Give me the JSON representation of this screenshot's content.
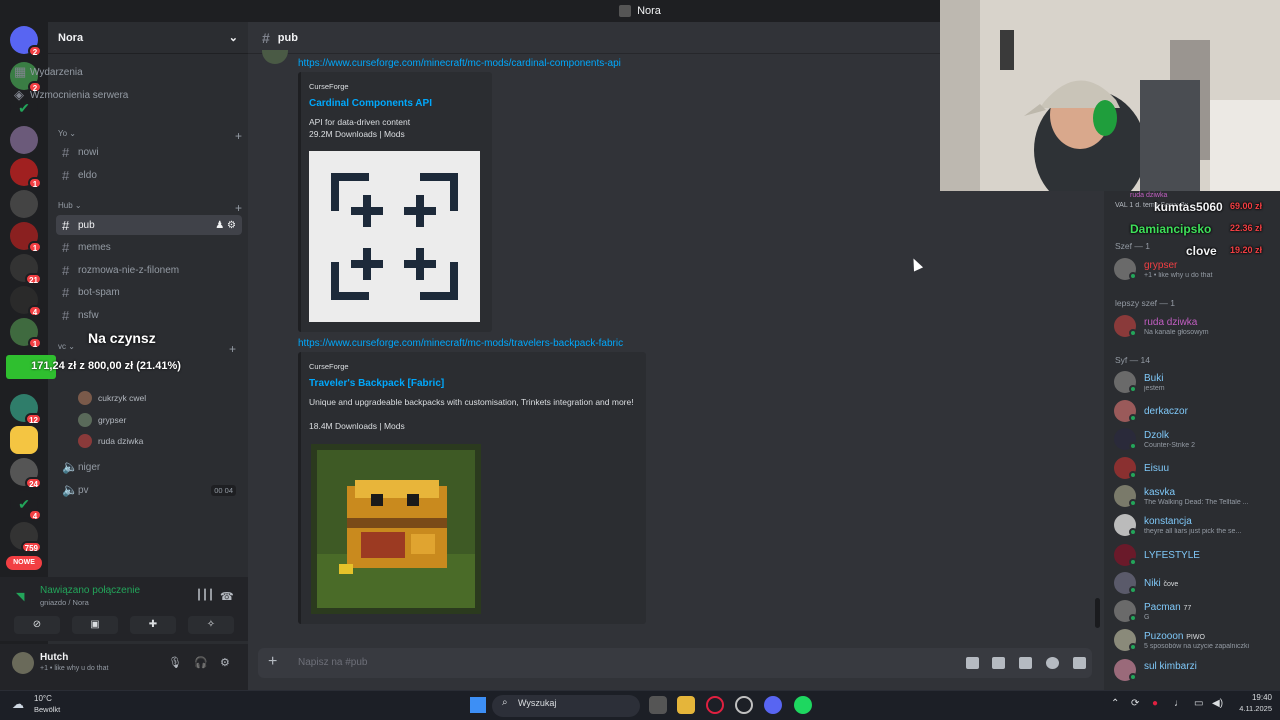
{
  "window": {
    "title": "Nora"
  },
  "server": {
    "name": "Nora",
    "top_items": [
      "Wydarzenia",
      "Wzmocnienia serwera"
    ],
    "categories": [
      {
        "name": "Yo",
        "channels": [
          "nowi",
          "eldo"
        ]
      },
      {
        "name": "Hub",
        "channels": [
          "pub",
          "memes",
          "rozmowa-nie-z-filonem",
          "bot-spam",
          "nsfw"
        ]
      },
      {
        "name": "vc"
      }
    ],
    "voice_users": [
      "cukrzyk cwel",
      "grypser",
      "ruda dziwka"
    ],
    "voice_channels": [
      {
        "name": "niger"
      },
      {
        "name": "pv",
        "count_a": "00",
        "count_b": "04"
      }
    ]
  },
  "rail_badges": [
    "2",
    "2",
    "1",
    "1",
    "1",
    "21",
    "4",
    "1",
    "12",
    "24",
    "4",
    "759"
  ],
  "rail_new_label": "NOWE",
  "overlay": {
    "rent_title": "Na czynsz",
    "rent_progress": "171,24 zł z 800,00 zł (21.41%)",
    "rent_fraction": 0.2141
  },
  "voice_panel": {
    "status": "Nawiązano połączenie",
    "location": "gniazdo / Nora"
  },
  "user_panel": {
    "name": "Hutch",
    "status": "+1 • like why u do that"
  },
  "chat": {
    "channel": "pub",
    "composer_placeholder": "Napisz na #pub",
    "messages": [
      {
        "link": "https://www.curseforge.com/minecraft/mc-mods/cardinal-components-api",
        "provider": "CurseForge",
        "title": "Cardinal Components API",
        "desc1": "API for data-driven content",
        "desc2": "29.2M Downloads | Mods"
      },
      {
        "link": "https://www.curseforge.com/minecraft/mc-mods/travelers-backpack-fabric",
        "provider": "CurseForge",
        "title": "Traveler's Backpack [Fabric]",
        "desc1": "Unique and upgradeable backpacks with customisation, Trinkets integration and more!",
        "desc2": "18.4M Downloads | Mods"
      }
    ]
  },
  "donations": [
    {
      "name": "kumtas5060",
      "amount": "69.00 zł"
    },
    {
      "name": "Damiancipsko",
      "amount": "22.36 zł"
    },
    {
      "name": "clove",
      "amount": "19.20 zł"
    }
  ],
  "members": {
    "top_user": {
      "name": "ruda dziwka",
      "sub": "VAL 1 d. temu  Seria: 3x"
    },
    "groups": [
      {
        "label": "Szef — 1",
        "users": [
          {
            "name": "grypser",
            "activity": "+1 • like why u do that",
            "color": "#f23f43"
          }
        ]
      },
      {
        "label": "lepszy szef — 1",
        "users": [
          {
            "name": "ruda dziwka",
            "activity": "Na kanale głosowym",
            "color": "#c25ec2"
          }
        ]
      },
      {
        "label": "Syf — 14",
        "users": [
          {
            "name": "Buki",
            "activity": "jestem",
            "color": "#7fc8f8"
          },
          {
            "name": "derkaczor",
            "activity": "",
            "color": "#7fc8f8"
          },
          {
            "name": "Dzolk",
            "activity": "Counter-Strike 2",
            "color": "#7fc8f8"
          },
          {
            "name": "Eisuu",
            "activity": "",
            "color": "#7fc8f8"
          },
          {
            "name": "kasvka",
            "activity": "The Walking Dead: The Telltale ...",
            "color": "#7fc8f8"
          },
          {
            "name": "konstancja",
            "activity": "theyre all liars just pick the se...",
            "color": "#7fc8f8"
          },
          {
            "name": "LYFESTYLE",
            "activity": "",
            "color": "#7fc8f8"
          },
          {
            "name": "Niki",
            "activity": "",
            "color": "#7fc8f8",
            "tag": "čove"
          },
          {
            "name": "Pacman",
            "activity": "G",
            "color": "#7fc8f8",
            "tag": "77"
          },
          {
            "name": "Puzooon",
            "activity": "5 sposobów na użycie zapalniczki",
            "color": "#7fc8f8",
            "tag": "PIWO"
          },
          {
            "name": "sul kimbarzi",
            "activity": "",
            "color": "#7fc8f8"
          }
        ]
      }
    ]
  },
  "taskbar": {
    "weather_temp": "10°C",
    "weather_desc": "Bewölkt",
    "search": "Wyszukaj",
    "time": "19:40",
    "date": "4.11.2025"
  }
}
